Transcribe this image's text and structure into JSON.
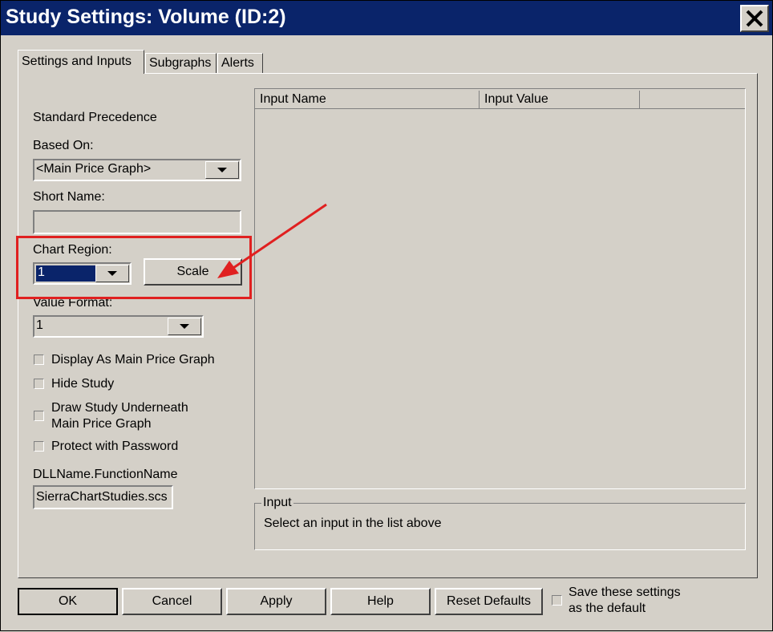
{
  "window": {
    "title": "Study Settings: Volume (ID:2)"
  },
  "tabs": [
    {
      "label": "Settings and Inputs",
      "active": true
    },
    {
      "label": "Subgraphs",
      "active": false
    },
    {
      "label": "Alerts",
      "active": false
    }
  ],
  "settings": {
    "standard_precedence_label": "Standard Precedence",
    "based_on": {
      "label": "Based On:",
      "value": "<Main Price Graph>"
    },
    "short_name": {
      "label": "Short Name:",
      "value": ""
    },
    "chart_region": {
      "label": "Chart Region:",
      "value": "1",
      "scale_button": "Scale"
    },
    "value_format": {
      "label": "Value Format:",
      "value": "1"
    },
    "checkboxes": {
      "display_as_main": {
        "label": "Display As Main Price Graph",
        "checked": false
      },
      "hide_study": {
        "label": "Hide Study",
        "checked": false
      },
      "draw_underneath": {
        "label_line1": "Draw Study Underneath",
        "label_line2": "Main Price Graph",
        "checked": false
      },
      "protect_password": {
        "label": "Protect with Password",
        "checked": false
      }
    },
    "dll": {
      "label": "DLLName.FunctionName",
      "value": "SierraChartStudies.scs"
    }
  },
  "inputs_list": {
    "columns": [
      "Input Name",
      "Input Value",
      ""
    ]
  },
  "input_group": {
    "title": "Input",
    "description": "Select an input in the list above"
  },
  "footer": {
    "ok": "OK",
    "cancel": "Cancel",
    "apply": "Apply",
    "help": "Help",
    "reset_defaults": "Reset Defaults",
    "save_default": {
      "label_line1": "Save these settings",
      "label_line2": "as the default",
      "checked": false
    }
  },
  "colors": {
    "title_bar": "#0a246a",
    "dialog_bg": "#d4d0c8",
    "selection": "#0a246a",
    "annotation": "#e02020"
  }
}
